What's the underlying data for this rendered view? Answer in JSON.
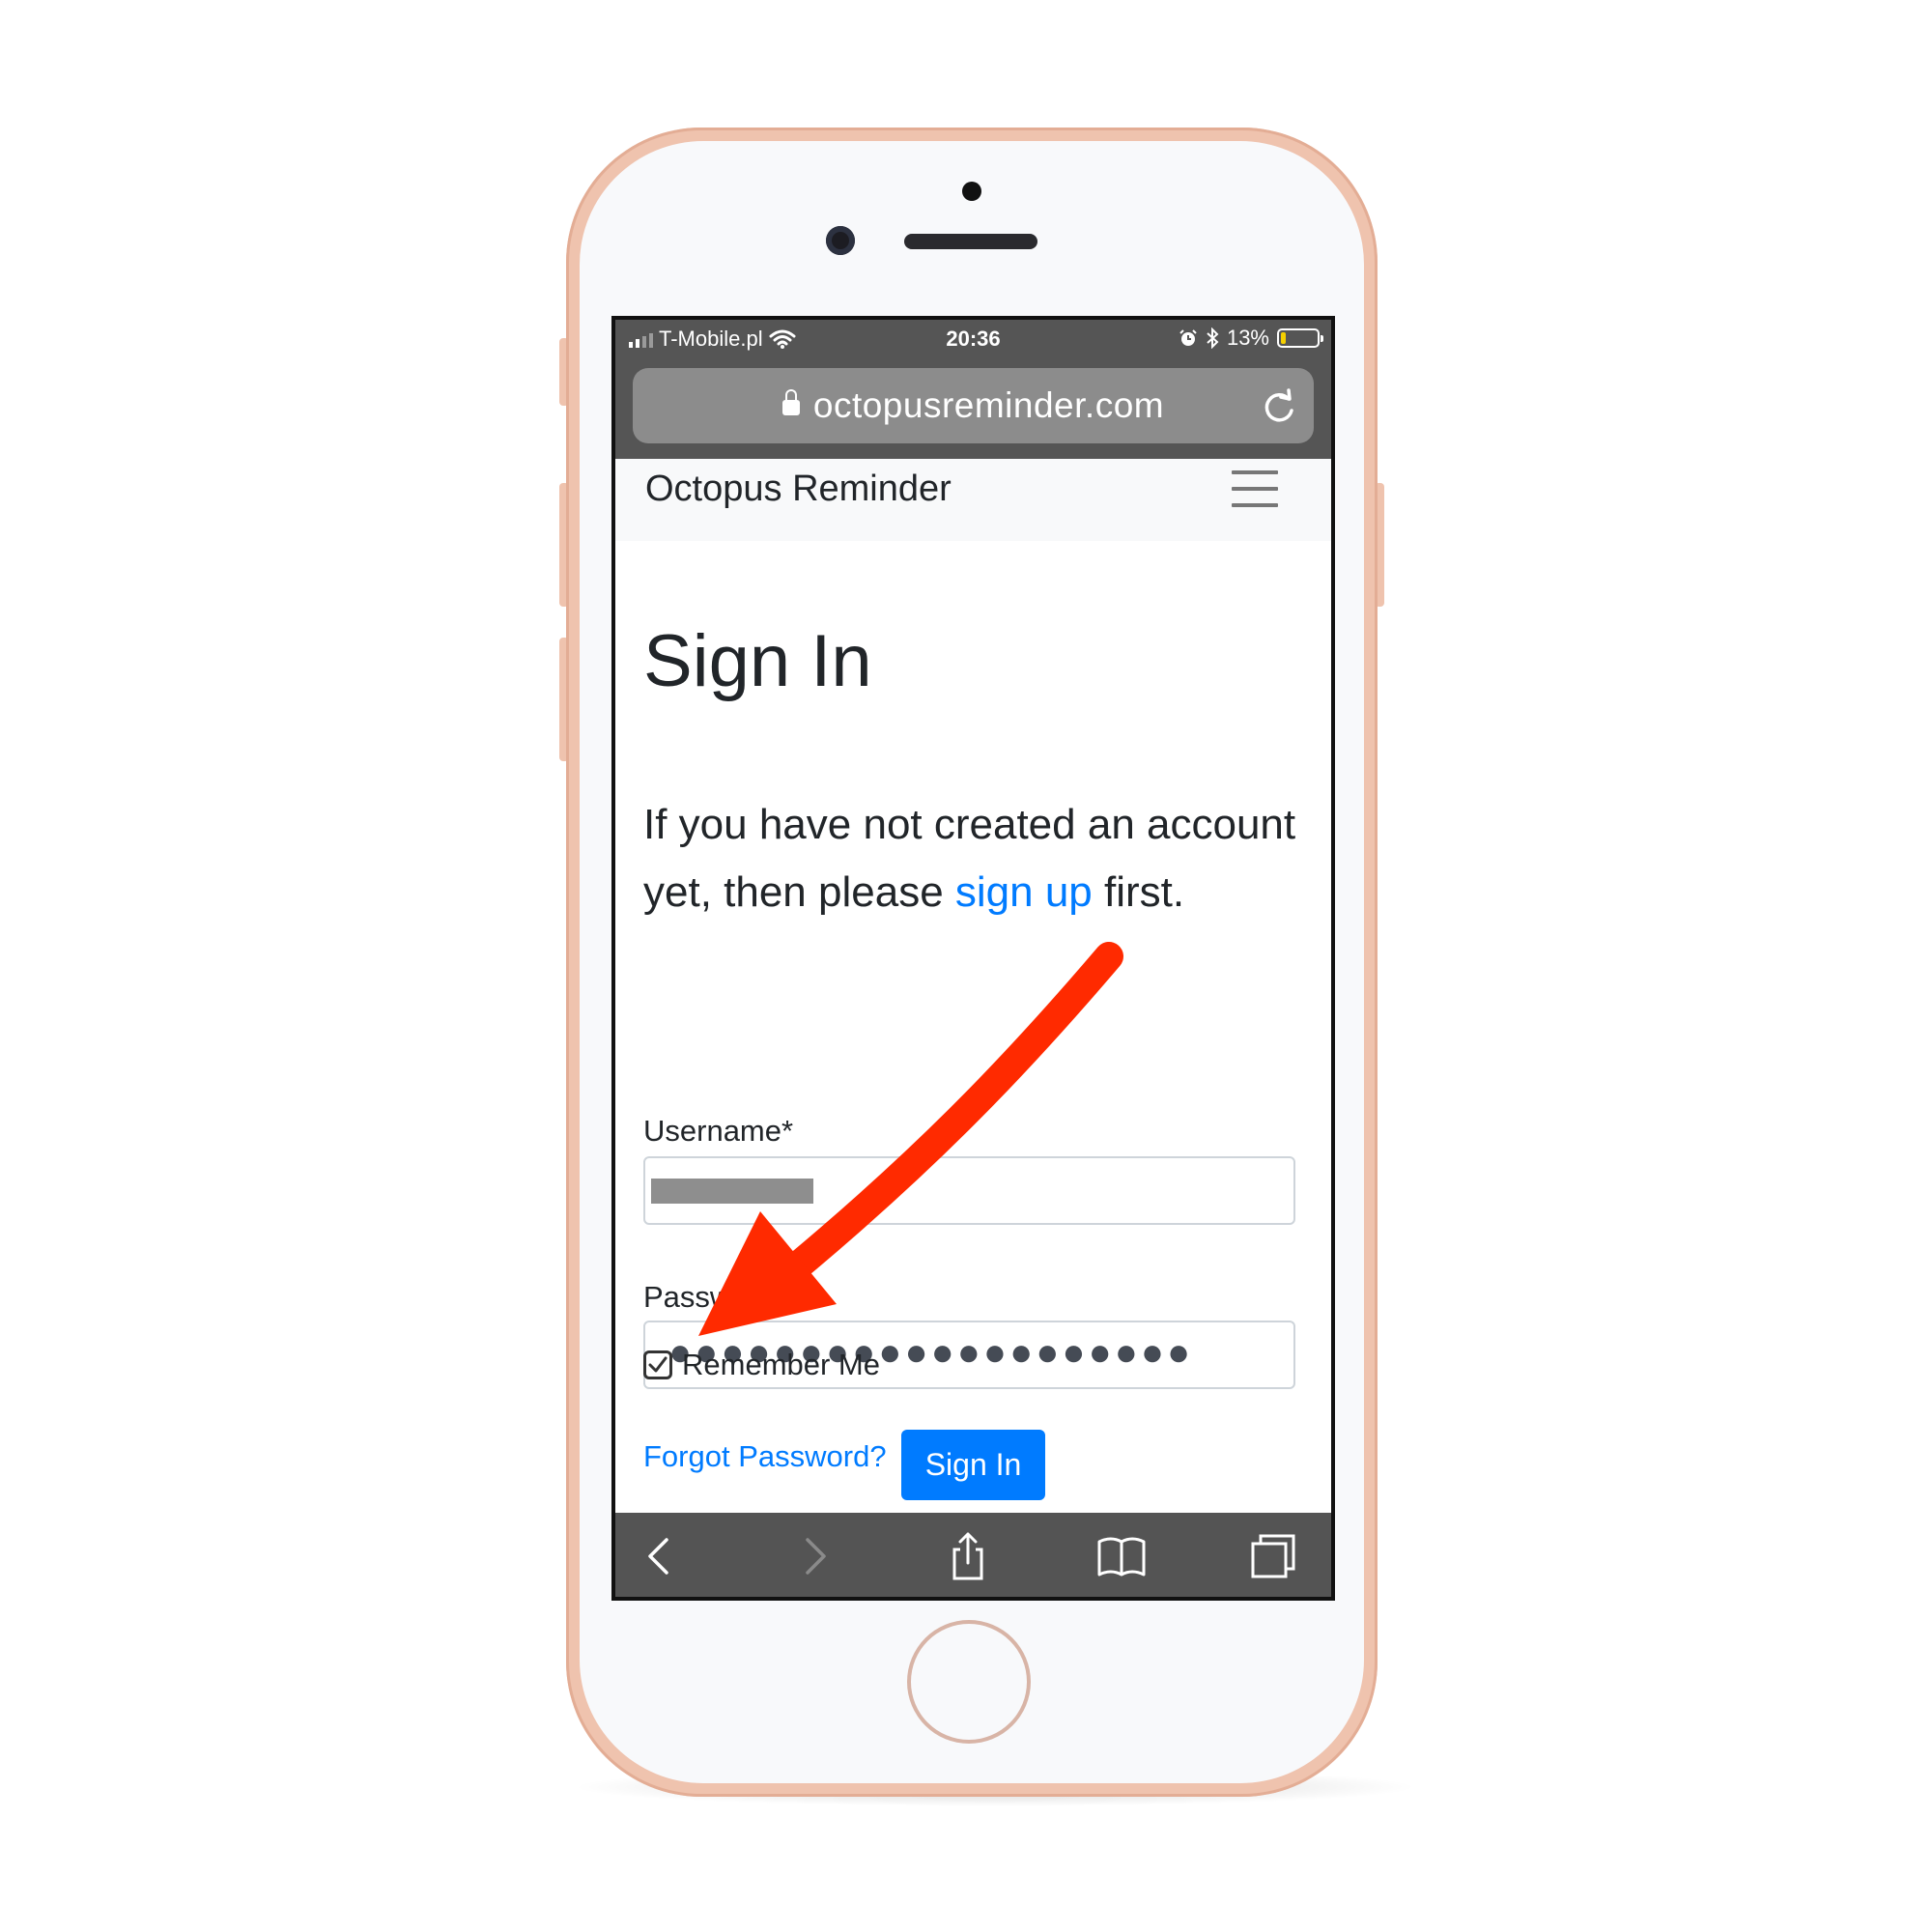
{
  "status_bar": {
    "carrier": "T-Mobile.pl",
    "time": "20:36",
    "battery_percent": "13%",
    "battery_level": 0.13,
    "battery_color": "#f5d000",
    "signal_icon": "signal-bars-icon",
    "wifi_icon": "wifi-icon",
    "alarm_icon": "alarm-icon",
    "bluetooth_icon": "bluetooth-icon"
  },
  "browser": {
    "url": "octopusreminder.com",
    "lock_icon": "lock-icon",
    "reload_icon": "reload-icon"
  },
  "navbar": {
    "brand": "Octopus Reminder",
    "menu_icon": "hamburger-icon"
  },
  "page": {
    "title": "Sign In",
    "intro_before": "If you have not created an account yet, then please ",
    "intro_link": "sign up",
    "intro_after": " first.",
    "username_label": "Username*",
    "password_label": "Password*",
    "password_mask": "●●●●●●●●●●●●●●●●●●●●",
    "remember_label": "Remember Me",
    "remember_checked": true,
    "forgot_label": "Forgot Password?",
    "signin_button": "Sign In"
  },
  "toolbar": {
    "back_icon": "chevron-left-icon",
    "forward_icon": "chevron-right-icon",
    "share_icon": "share-icon",
    "bookmarks_icon": "book-icon",
    "tabs_icon": "tabs-icon"
  },
  "colors": {
    "link": "#007bff",
    "primary_button": "#007bff",
    "annotation_arrow": "#ff2a00",
    "phone_body": "#efc3ae"
  }
}
